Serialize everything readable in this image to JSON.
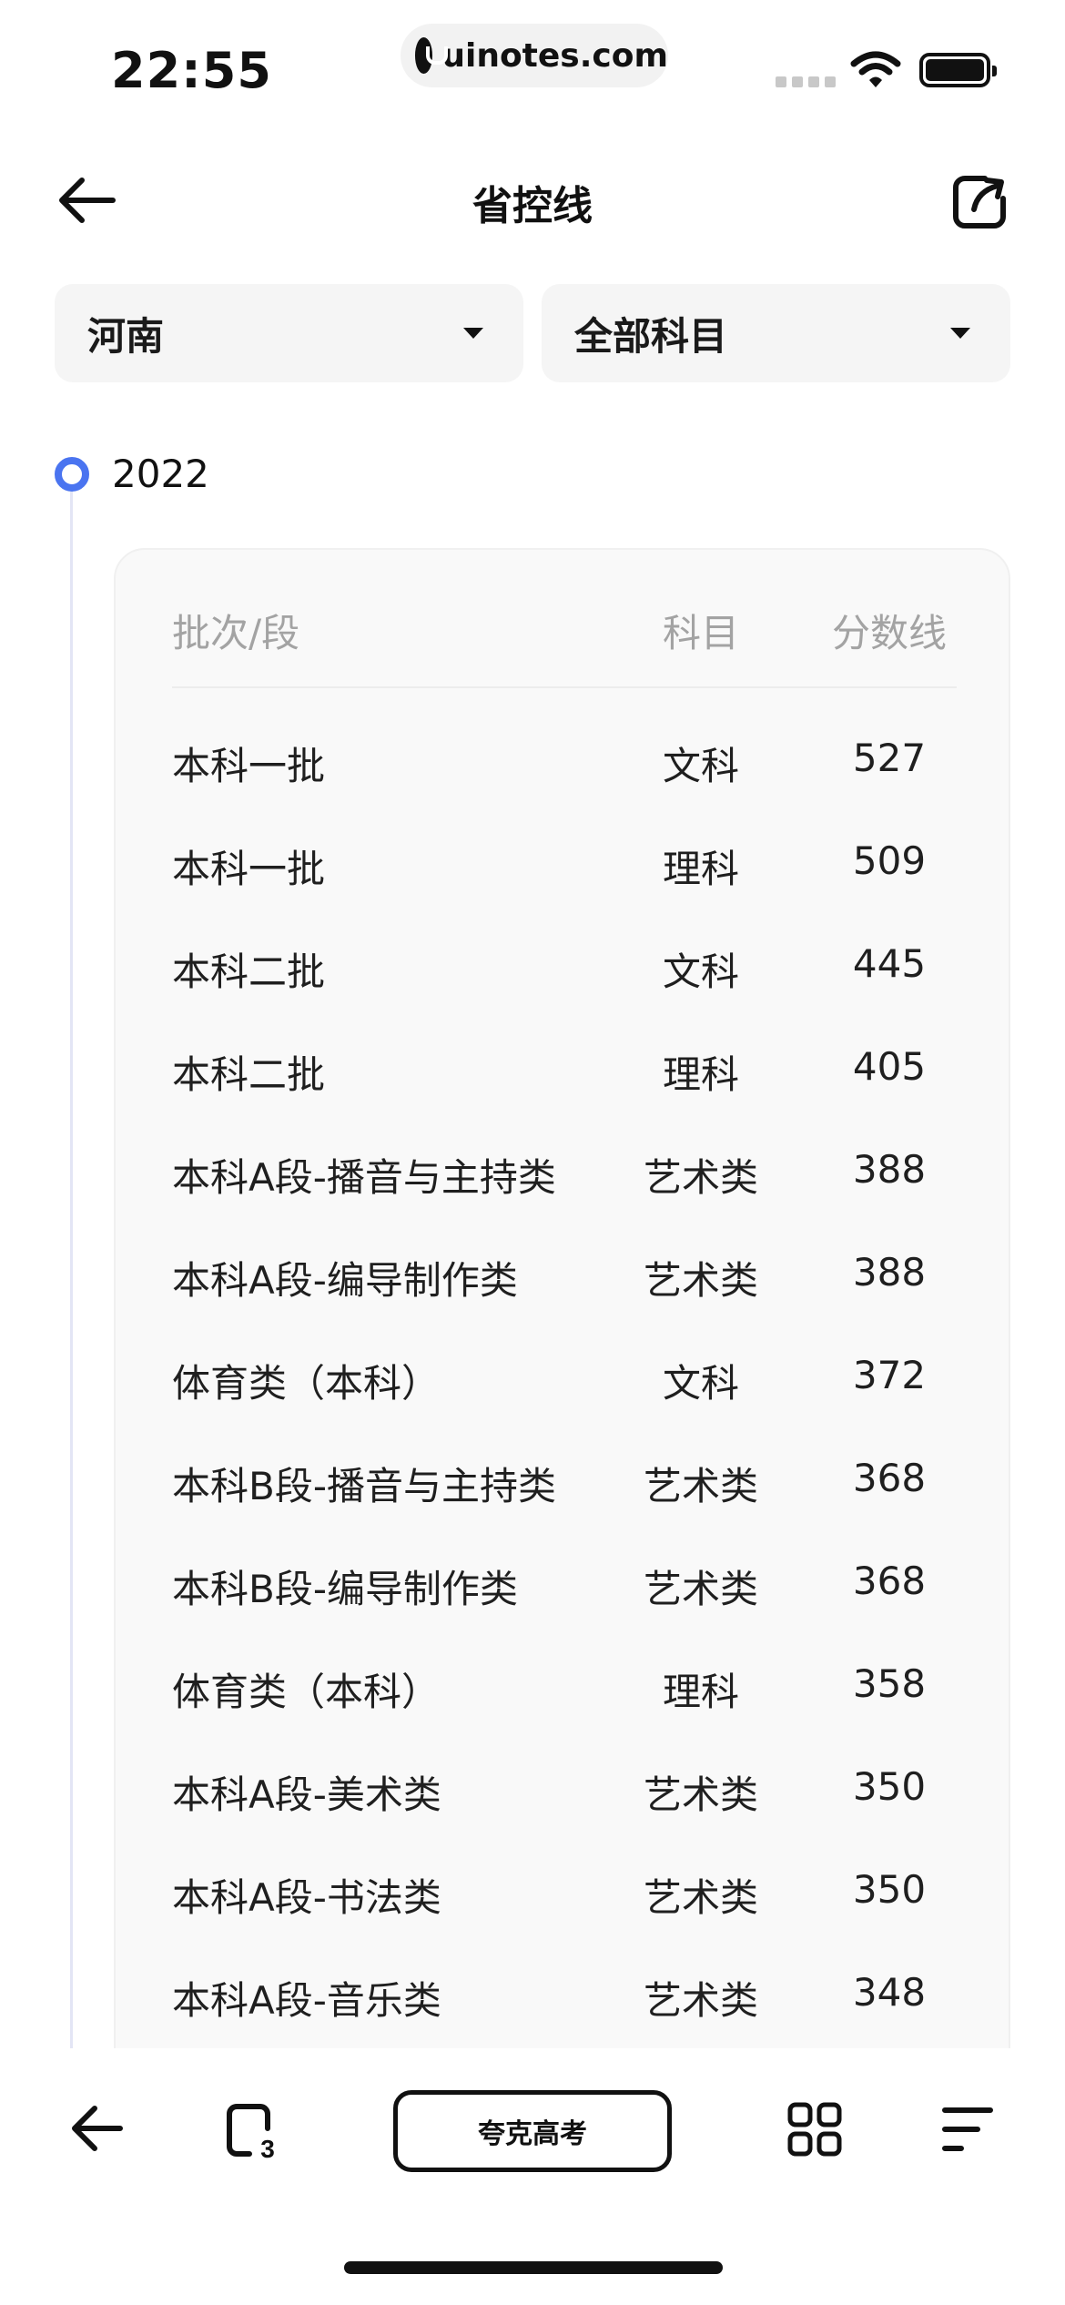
{
  "status_bar": {
    "time": "22:55",
    "url": "uinotes.com"
  },
  "header": {
    "title": "省控线"
  },
  "filters": {
    "province": "河南",
    "subject": "全部科目"
  },
  "timeline": {
    "year": "2022"
  },
  "table": {
    "headers": [
      "批次/段",
      "科目",
      "分数线"
    ],
    "rows": [
      {
        "batch": "本科一批",
        "subject": "文科",
        "score": "527"
      },
      {
        "batch": "本科一批",
        "subject": "理科",
        "score": "509"
      },
      {
        "batch": "本科二批",
        "subject": "文科",
        "score": "445"
      },
      {
        "batch": "本科二批",
        "subject": "理科",
        "score": "405"
      },
      {
        "batch": "本科A段-播音与主持类",
        "subject": "艺术类",
        "score": "388"
      },
      {
        "batch": "本科A段-编导制作类",
        "subject": "艺术类",
        "score": "388"
      },
      {
        "batch": "体育类（本科）",
        "subject": "文科",
        "score": "372"
      },
      {
        "batch": "本科B段-播音与主持类",
        "subject": "艺术类",
        "score": "368"
      },
      {
        "batch": "本科B段-编导制作类",
        "subject": "艺术类",
        "score": "368"
      },
      {
        "batch": "体育类（本科）",
        "subject": "理科",
        "score": "358"
      },
      {
        "batch": "本科A段-美术类",
        "subject": "艺术类",
        "score": "350"
      },
      {
        "batch": "本科A段-书法类",
        "subject": "艺术类",
        "score": "350"
      },
      {
        "batch": "本科A段-音乐类",
        "subject": "艺术类",
        "score": "348"
      }
    ]
  },
  "bottom_bar": {
    "center_label": "夸克高考",
    "tab_count": "3"
  },
  "icons": {
    "back": "arrow-left",
    "share": "share-out",
    "tabs": "tab-switcher",
    "grid": "app-grid",
    "menu": "menu-lines"
  },
  "colors": {
    "accent": "#4a74f0"
  }
}
